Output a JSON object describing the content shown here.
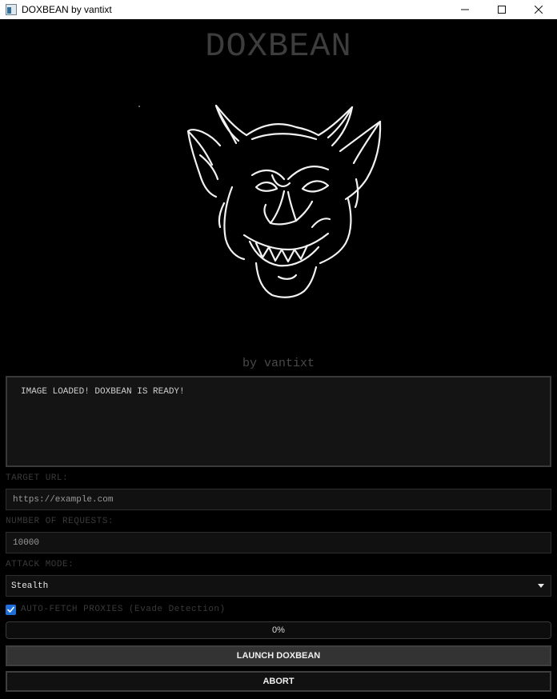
{
  "window": {
    "title": "DOXBEAN by vantixt",
    "controls": [
      "minimize",
      "maximize",
      "close"
    ]
  },
  "header": {
    "title": "DOXBEAN",
    "subtitle": "by vantixt",
    "image_icon": "devil-face-sketch-icon"
  },
  "log": {
    "message": "IMAGE LOADED! DOXBEAN IS READY!"
  },
  "form": {
    "target_url_label": "TARGET URL:",
    "target_url_value": "https://example.com",
    "requests_label": "NUMBER OF REQUESTS:",
    "requests_value": "10000",
    "attack_mode_label": "ATTACK MODE:",
    "attack_mode_value": "Stealth",
    "proxies_label": "AUTO-FETCH PROXIES (Evade Detection)",
    "proxies_checked": true
  },
  "progress": {
    "value": 0,
    "text": "0%"
  },
  "buttons": {
    "launch": "LAUNCH DOXBEAN",
    "abort": "ABORT"
  },
  "colors": {
    "background": "#000000",
    "accent": "#1e6fd9",
    "text_dim": "#3a3a3a"
  }
}
